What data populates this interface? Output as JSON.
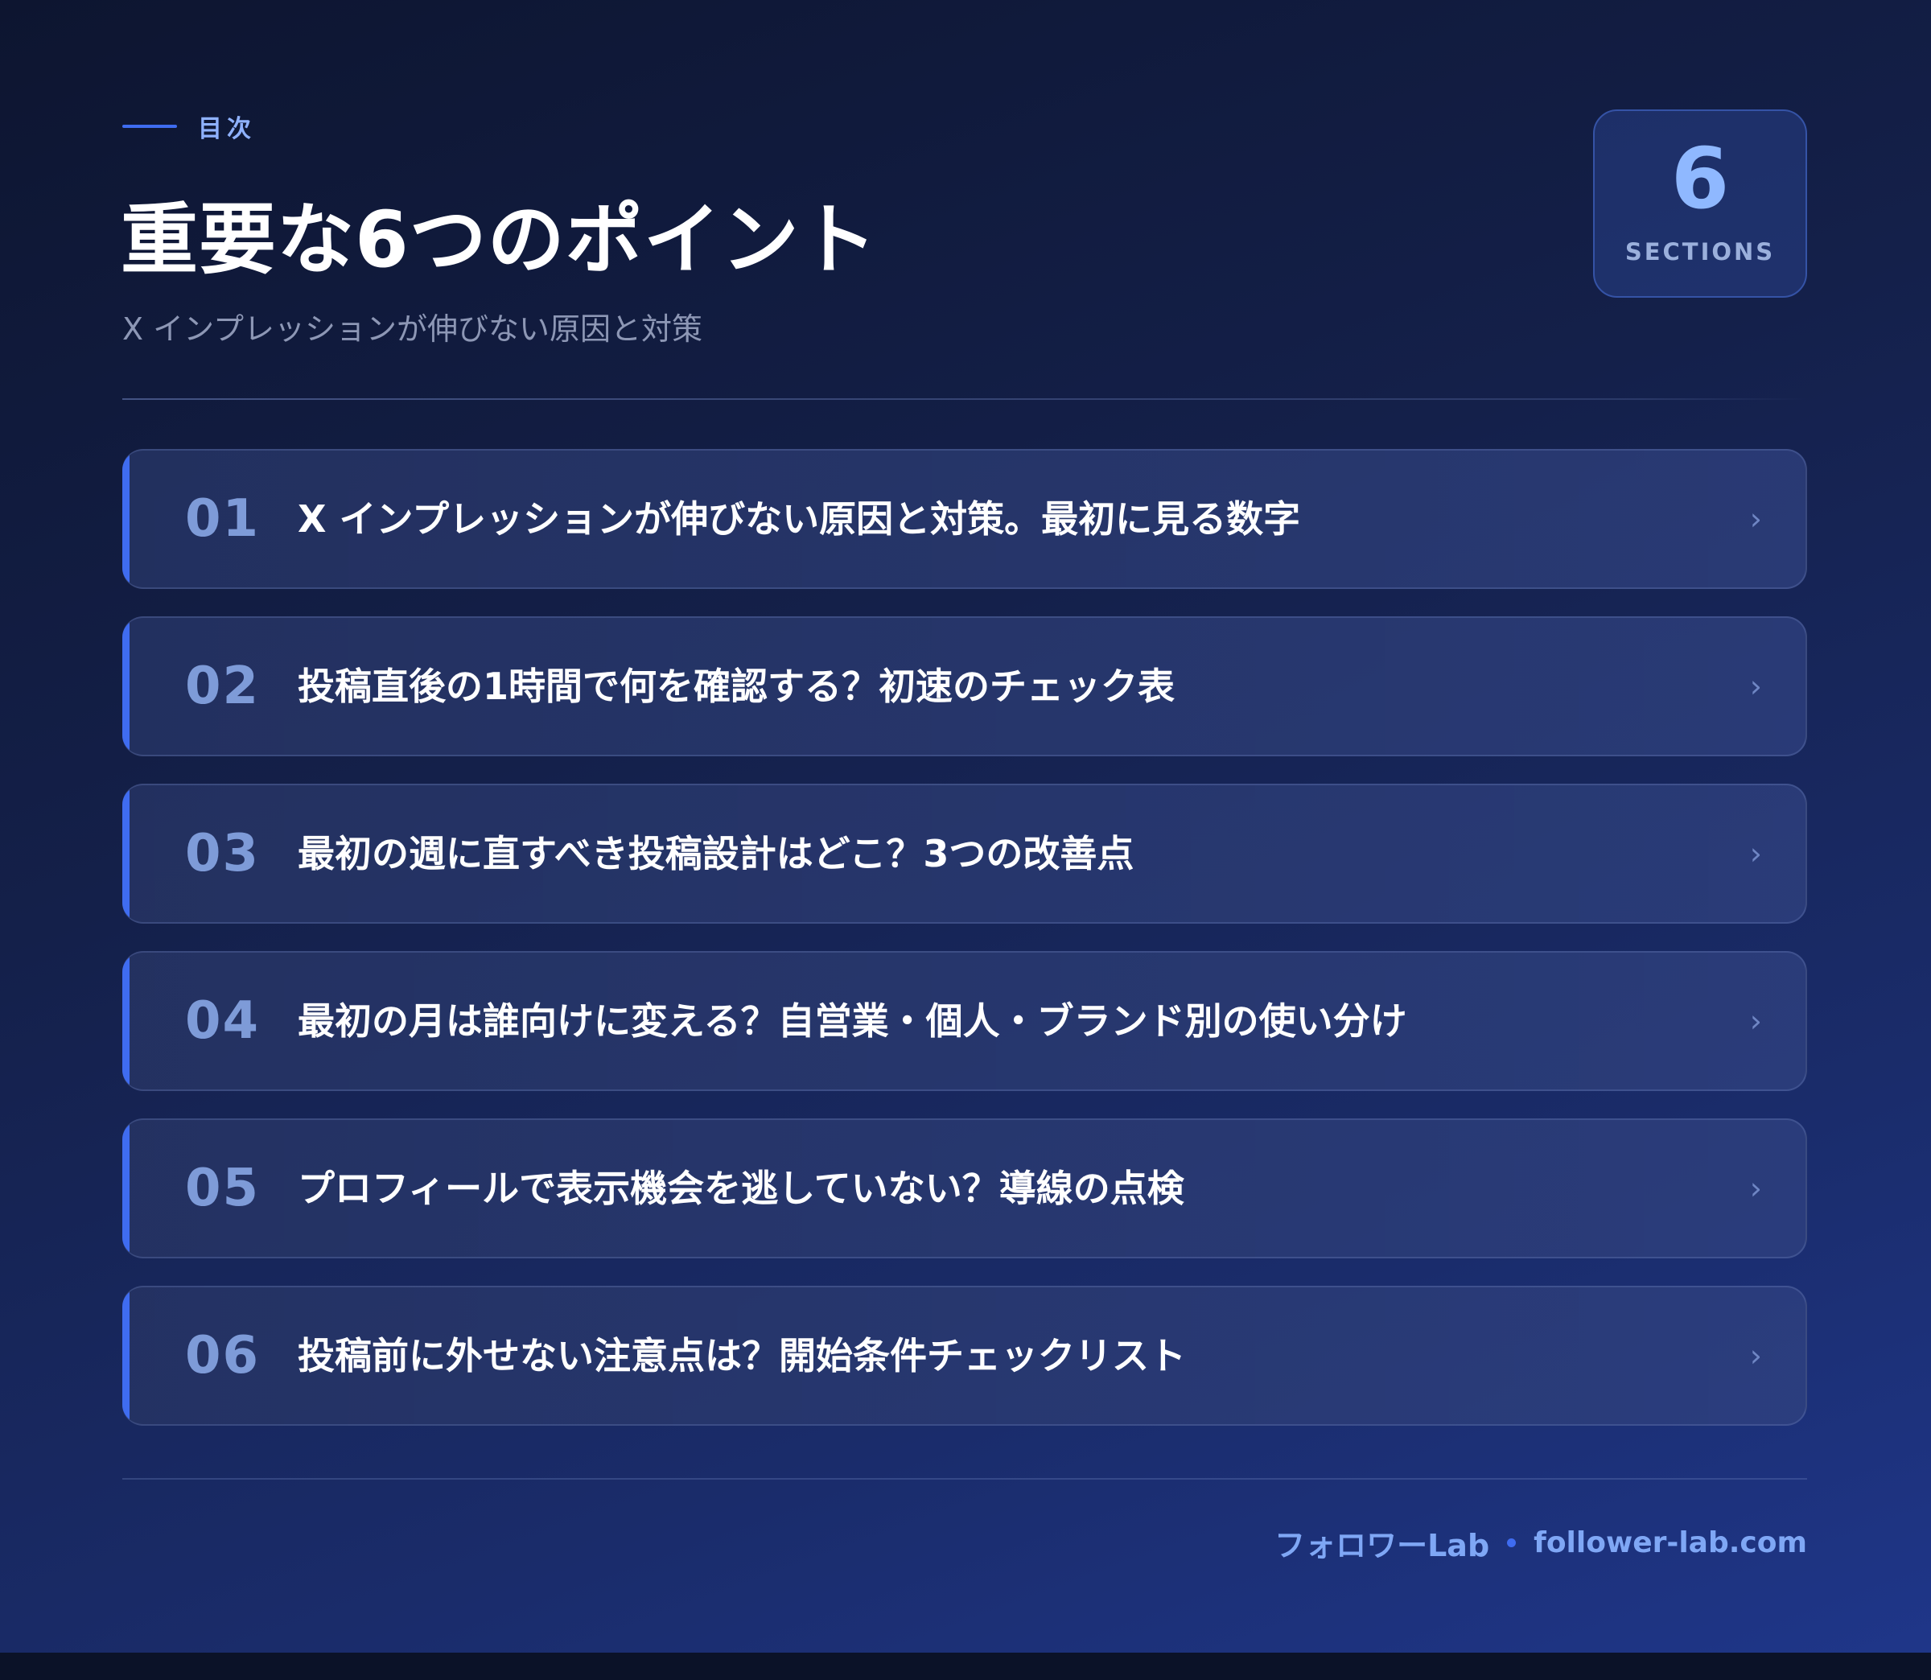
{
  "header": {
    "eyebrow": "目次",
    "title": "重要な6つのポイント",
    "subtitle": "X インプレッションが伸びない原因と対策"
  },
  "badge": {
    "count": "6",
    "label": "SECTIONS"
  },
  "items": [
    {
      "num": "01",
      "text": "X インプレッションが伸びない原因と対策。最初に見る数字",
      "chevron": "›"
    },
    {
      "num": "02",
      "text": "投稿直後の1時間で何を確認する？初速のチェック表",
      "chevron": "›"
    },
    {
      "num": "03",
      "text": "最初の週に直すべき投稿設計はどこ？3つの改善点",
      "chevron": "›"
    },
    {
      "num": "04",
      "text": "最初の月は誰向けに変える？自営業・個人・ブランド別の使い分け",
      "chevron": "›"
    },
    {
      "num": "05",
      "text": "プロフィールで表示機会を逃していない？導線の点検",
      "chevron": "›"
    },
    {
      "num": "06",
      "text": "投稿前に外せない注意点は？開始条件チェックリスト",
      "chevron": "›"
    }
  ],
  "footer": {
    "brand": "フォロワーLab",
    "domain": "follower-lab.com"
  },
  "colors": {
    "accent": "#3f6cf0",
    "number": "#7e9bd8",
    "footer_text": "#7fa7f5"
  }
}
